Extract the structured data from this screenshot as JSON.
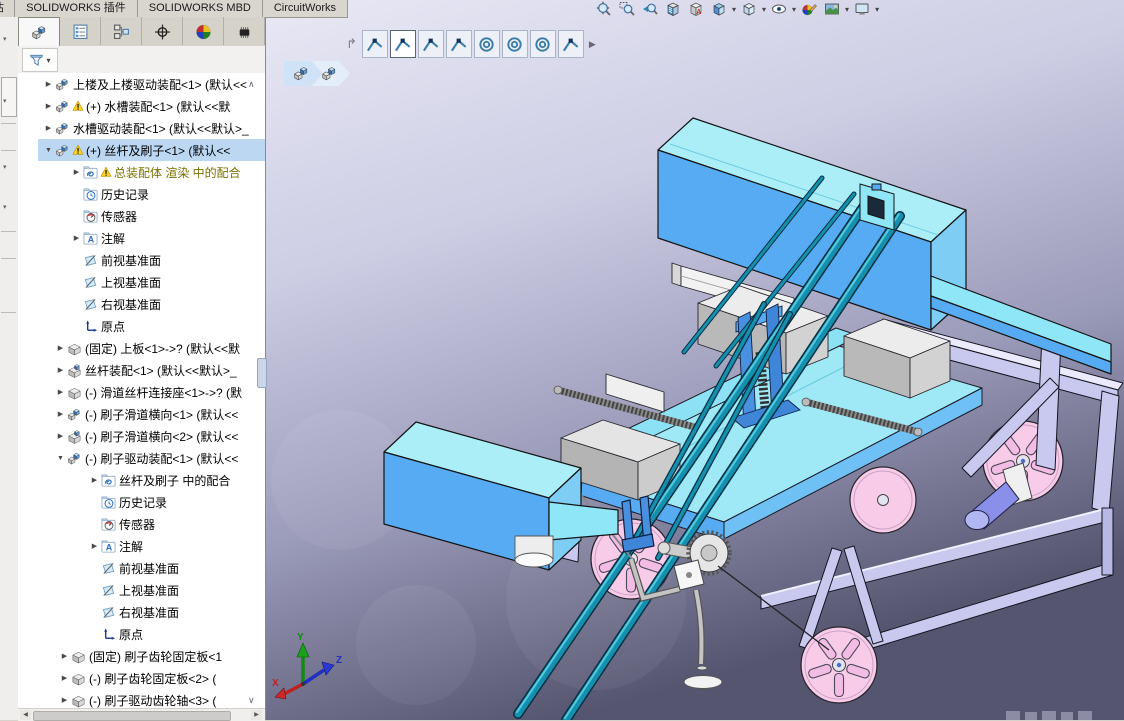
{
  "window_tabs": {
    "clipped_tab": "估",
    "tabs": [
      "SOLIDWORKS 插件",
      "SOLIDWORKS MBD",
      "CircuitWorks"
    ]
  },
  "headsup_toolbar": {
    "tools": [
      {
        "name": "zoom-to-fit"
      },
      {
        "name": "zoom-to-area"
      },
      {
        "name": "previous-view"
      },
      {
        "name": "section-view"
      },
      {
        "name": "view-annotations"
      },
      {
        "name": "view-orientation",
        "caret": true
      },
      {
        "name": "display-style",
        "caret": true
      },
      {
        "name": "hide-show-items",
        "caret": true
      },
      {
        "name": "edit-appearance"
      },
      {
        "name": "apply-scene",
        "caret": true
      },
      {
        "name": "view-settings",
        "caret": true
      }
    ]
  },
  "context_toolbar": {
    "back_glyph": "↱",
    "buttons": [
      {
        "type": "coincident"
      },
      {
        "type": "coincident",
        "selected": true
      },
      {
        "type": "coincident"
      },
      {
        "type": "coincident"
      },
      {
        "type": "concentric"
      },
      {
        "type": "concentric"
      },
      {
        "type": "concentric"
      },
      {
        "type": "coincident"
      }
    ],
    "more_glyph": "▶"
  },
  "breadcrumbs": {
    "items": [
      "assembly",
      "subassembly"
    ]
  },
  "panel": {
    "tabs": [
      "featuremanager",
      "propertymanager",
      "configurationmanager",
      "dimxpertmanager",
      "displaymanager",
      "circuitworks"
    ],
    "active_tab_index": 0,
    "tree": {
      "rows": [
        {
          "indent": 24,
          "arrow": "r",
          "icon": "assembly",
          "warn": false,
          "label": "上楼及上楼驱动装配<1> (默认<<"
        },
        {
          "indent": 24,
          "arrow": "r",
          "icon": "assembly",
          "warn": true,
          "label": "(+) 水槽装配<1> (默认<<默"
        },
        {
          "indent": 24,
          "arrow": "r",
          "icon": "assembly",
          "warn": false,
          "label": "水槽驱动装配<1> (默认<<默认>_"
        },
        {
          "indent": 24,
          "arrow": "d",
          "icon": "assembly",
          "warn": true,
          "label": "(+) 丝杆及刷子<1> (默认<<",
          "selected": true
        },
        {
          "indent": 52,
          "arrow": "r",
          "icon": "mates",
          "warn": true,
          "label": "总装配体 渲染 中的配合",
          "color": "#7a7000"
        },
        {
          "indent": 52,
          "arrow": "",
          "icon": "history",
          "warn": false,
          "label": "历史记录"
        },
        {
          "indent": 52,
          "arrow": "",
          "icon": "sensors",
          "warn": false,
          "label": "传感器"
        },
        {
          "indent": 52,
          "arrow": "r",
          "icon": "annotations",
          "warn": false,
          "label": "注解"
        },
        {
          "indent": 52,
          "arrow": "",
          "icon": "plane",
          "warn": false,
          "label": "前视基准面"
        },
        {
          "indent": 52,
          "arrow": "",
          "icon": "plane",
          "warn": false,
          "label": "上视基准面"
        },
        {
          "indent": 52,
          "arrow": "",
          "icon": "plane",
          "warn": false,
          "label": "右视基准面"
        },
        {
          "indent": 52,
          "arrow": "",
          "icon": "origin",
          "warn": false,
          "label": "原点"
        },
        {
          "indent": 36,
          "arrow": "r",
          "icon": "part",
          "warn": false,
          "label": "(固定) 上板<1>->? (默认<<默"
        },
        {
          "indent": 36,
          "arrow": "r",
          "icon": "part-blue",
          "warn": false,
          "label": "丝杆装配<1> (默认<<默认>_"
        },
        {
          "indent": 36,
          "arrow": "r",
          "icon": "part",
          "warn": false,
          "label": "(-) 滑道丝杆连接座<1>->? (默"
        },
        {
          "indent": 36,
          "arrow": "r",
          "icon": "assembly",
          "warn": false,
          "label": "(-) 刷子滑道横向<1> (默认<<"
        },
        {
          "indent": 36,
          "arrow": "r",
          "icon": "part-blue",
          "warn": false,
          "label": "(-) 刷子滑道横向<2> (默认<<"
        },
        {
          "indent": 36,
          "arrow": "d",
          "icon": "assembly",
          "warn": false,
          "label": "(-) 刷子驱动装配<1> (默认<<"
        },
        {
          "indent": 70,
          "arrow": "r",
          "icon": "mates",
          "warn": false,
          "label": "丝杆及刷子 中的配合"
        },
        {
          "indent": 70,
          "arrow": "",
          "icon": "history",
          "warn": false,
          "label": "历史记录"
        },
        {
          "indent": 70,
          "arrow": "",
          "icon": "sensors",
          "warn": false,
          "label": "传感器"
        },
        {
          "indent": 70,
          "arrow": "r",
          "icon": "annotations",
          "warn": false,
          "label": "注解"
        },
        {
          "indent": 70,
          "arrow": "",
          "icon": "plane",
          "warn": false,
          "label": "前视基准面"
        },
        {
          "indent": 70,
          "arrow": "",
          "icon": "plane",
          "warn": false,
          "label": "上视基准面"
        },
        {
          "indent": 70,
          "arrow": "",
          "icon": "plane",
          "warn": false,
          "label": "右视基准面"
        },
        {
          "indent": 70,
          "arrow": "",
          "icon": "origin",
          "warn": false,
          "label": "原点"
        },
        {
          "indent": 40,
          "arrow": "r",
          "icon": "part",
          "warn": false,
          "label": "(固定) 刷子齿轮固定板<1"
        },
        {
          "indent": 40,
          "arrow": "r",
          "icon": "part",
          "warn": false,
          "label": "(-) 刷子齿轮固定板<2> ("
        },
        {
          "indent": 40,
          "arrow": "r",
          "icon": "part",
          "warn": false,
          "label": "(-) 刷子驱动齿轮轴<3> ("
        }
      ]
    }
  },
  "viewport": {
    "triad": {
      "x_label": "X",
      "y_label": "Y",
      "z_label": "Z"
    },
    "colors": {
      "background_top": "#e8e8f5",
      "background_bottom": "#555570",
      "machine_cyan_top": "#aceef8",
      "machine_blue_front": "#57abf2",
      "machine_teal_rail": "#1490ae",
      "frame_lavender": "#c9c9f0",
      "wheel_pink": "#f8cbe9",
      "part_gray": "#c9c9c9",
      "motor_violet": "#8a8fe9"
    }
  }
}
